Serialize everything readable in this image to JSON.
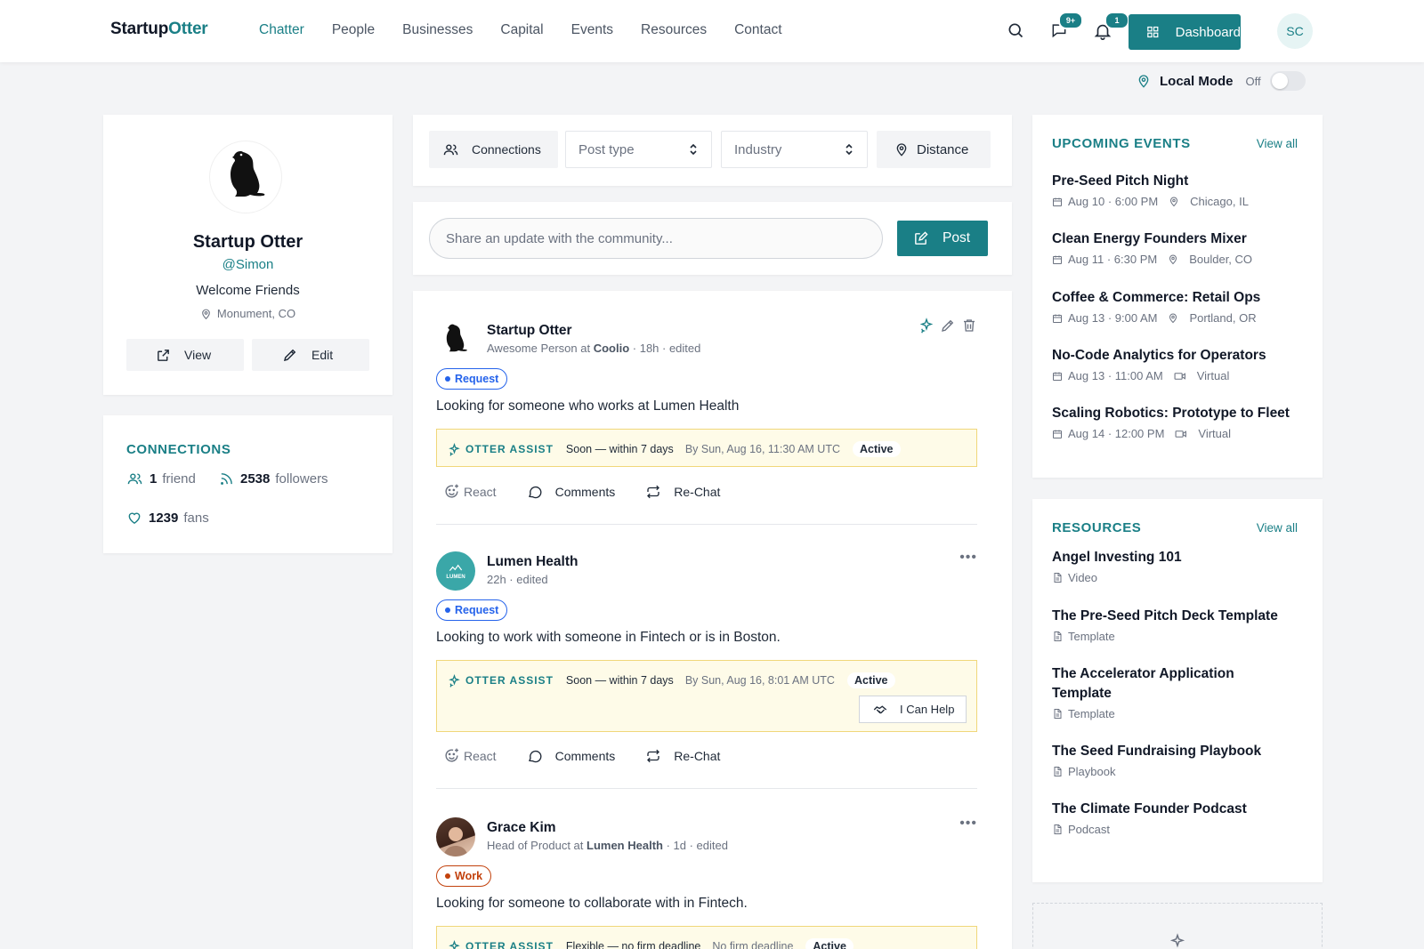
{
  "brand": {
    "part1": "Startup",
    "part2": "Otter"
  },
  "nav": {
    "links": [
      "Chatter",
      "People",
      "Businesses",
      "Capital",
      "Events",
      "Resources",
      "Contact"
    ],
    "active": "Chatter"
  },
  "header": {
    "messages_badge": "9+",
    "notifications_badge": "1",
    "dashboard_label": "Dashboard",
    "user_initials": "SC"
  },
  "local_mode": {
    "label": "Local Mode",
    "state": "Off"
  },
  "profile": {
    "name": "Startup Otter",
    "handle": "@Simon",
    "bio": "Welcome Friends",
    "location": "Monument, CO",
    "view_label": "View",
    "edit_label": "Edit"
  },
  "connections": {
    "title": "CONNECTIONS",
    "friends_count": "1",
    "friends_label": "friend",
    "followers_count": "2538",
    "followers_label": "followers",
    "fans_count": "1239",
    "fans_label": "fans"
  },
  "filters": {
    "connections": "Connections",
    "post_type": "Post type",
    "industry": "Industry",
    "distance": "Distance"
  },
  "composer": {
    "placeholder": "Share an update with the community...",
    "post_label": "Post"
  },
  "posts": [
    {
      "author": "Startup Otter",
      "meta_prefix": "Awesome Person at ",
      "meta_company": "Coolio",
      "meta_suffix": " · 18h · edited",
      "tag": "Request",
      "text": "Looking for someone who works at Lumen Health",
      "assist": {
        "brand": "OTTER ASSIST",
        "timing": "Soon — within 7 days",
        "by": "By Sun, Aug 16, 11:30 AM UTC",
        "status": "Active"
      },
      "actions": {
        "react": "React",
        "comments": "Comments",
        "rechat": "Re-Chat"
      }
    },
    {
      "author": "Lumen Health",
      "meta": "22h · edited",
      "avatar_text": "LUMEN",
      "tag": "Request",
      "text": "Looking to work with someone in Fintech or is in Boston.",
      "assist": {
        "brand": "OTTER ASSIST",
        "timing": "Soon — within 7 days",
        "by": "By Sun, Aug 16, 8:01 AM UTC",
        "status": "Active",
        "help": "I Can Help"
      },
      "actions": {
        "react": "React",
        "comments": "Comments",
        "rechat": "Re-Chat"
      }
    },
    {
      "author": "Grace Kim",
      "meta_prefix": "Head of Product at ",
      "meta_company": "Lumen Health",
      "meta_suffix": " · 1d · edited",
      "tag": "Work",
      "text": "Looking for someone to collaborate with in Fintech.",
      "assist": {
        "brand": "OTTER ASSIST",
        "timing": "Flexible — no firm deadline",
        "by": "No firm deadline",
        "status": "Active"
      }
    }
  ],
  "events": {
    "title": "UPCOMING EVENTS",
    "view_all": "View all",
    "items": [
      {
        "title": "Pre-Seed Pitch Night",
        "date": "Aug 10 · 6:00 PM",
        "place": "Chicago, IL",
        "kind": "location"
      },
      {
        "title": "Clean Energy Founders Mixer",
        "date": "Aug 11 · 6:30 PM",
        "place": "Boulder, CO",
        "kind": "location"
      },
      {
        "title": "Coffee & Commerce: Retail Ops",
        "date": "Aug 13 · 9:00 AM",
        "place": "Portland, OR",
        "kind": "location"
      },
      {
        "title": "No-Code Analytics for Operators",
        "date": "Aug 13 · 11:00 AM",
        "place": "Virtual",
        "kind": "virtual"
      },
      {
        "title": "Scaling Robotics: Prototype to Fleet",
        "date": "Aug 14 · 12:00 PM",
        "place": "Virtual",
        "kind": "virtual"
      }
    ]
  },
  "resources": {
    "title": "RESOURCES",
    "view_all": "View all",
    "items": [
      {
        "title": "Angel Investing 101",
        "type": "Video"
      },
      {
        "title": "The Pre-Seed Pitch Deck Template",
        "type": "Template"
      },
      {
        "title": "The Accelerator Application Template",
        "type": "Template"
      },
      {
        "title": "The Seed Fundraising Playbook",
        "type": "Playbook"
      },
      {
        "title": "The Climate Founder Podcast",
        "type": "Podcast"
      }
    ]
  }
}
